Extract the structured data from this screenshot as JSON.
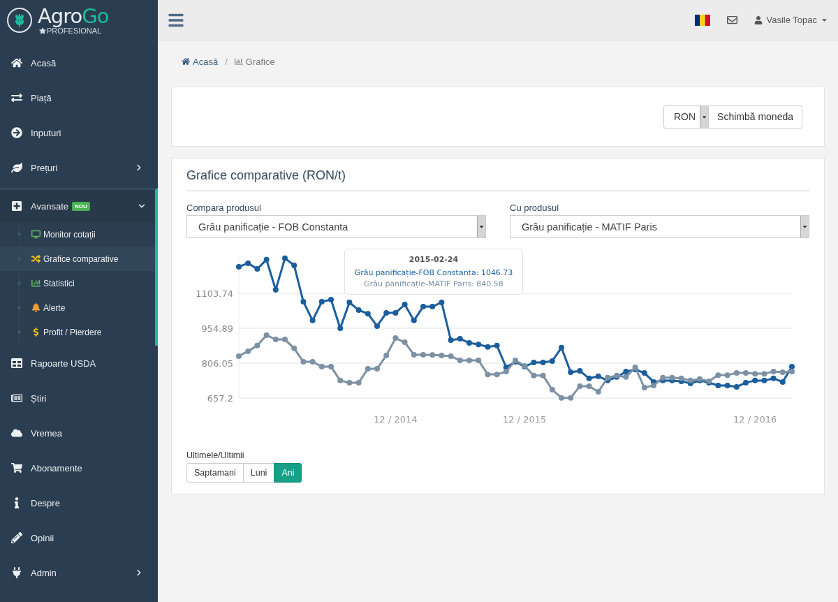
{
  "logo": {
    "name_start": "Agro",
    "name_end": "Go",
    "tagline": "PROFESIONAL"
  },
  "sidebar": {
    "items": [
      {
        "label": "Acasă",
        "selected": false
      },
      {
        "label": "Piață",
        "selected": false
      },
      {
        "label": "Inputuri",
        "selected": false
      },
      {
        "label": "Prețuri",
        "selected": false,
        "expanded": false
      },
      {
        "label": "Avansate",
        "badge": "NOU",
        "selected": true,
        "expanded": true,
        "children": [
          {
            "label": "Monitor cotații",
            "selected": false
          },
          {
            "label": "Grafice comparative",
            "selected": true
          },
          {
            "label": "Statistici",
            "selected": false
          },
          {
            "label": "Alerte",
            "selected": false
          },
          {
            "label": "Profit / Pierdere",
            "selected": false
          }
        ]
      },
      {
        "label": "Rapoarte USDA",
        "selected": false
      },
      {
        "label": "Știri",
        "selected": false
      },
      {
        "label": "Vremea",
        "selected": false
      },
      {
        "label": "Abonamente",
        "selected": false
      },
      {
        "label": "Despre",
        "selected": false
      },
      {
        "label": "Opinii",
        "selected": false
      },
      {
        "label": "Admin",
        "selected": false,
        "expanded": false
      }
    ]
  },
  "header": {
    "user": "Vasile Topac"
  },
  "breadcrumb_separator": "/",
  "breadcrumb": [
    {
      "label": "Acasă",
      "current": false
    },
    {
      "label": "Grafice",
      "current": true
    }
  ],
  "currency": {
    "value": "RON",
    "button": "Schimbă moneda"
  },
  "chart_panel": {
    "title": "Grafice comparative (RON/t)",
    "selects": [
      {
        "label": "Compara produsul",
        "value": "Grâu panificație - FOB Constanta"
      },
      {
        "label": "Cu produsul",
        "value": "Grâu panificație - MATIF Paris"
      }
    ],
    "chart_data": {
      "type": "line",
      "categories": [
        null,
        null,
        null,
        null,
        null,
        null,
        null,
        null,
        null,
        null,
        null,
        null,
        null,
        null,
        null,
        null,
        null,
        "12 / 2014",
        null,
        null,
        null,
        null,
        null,
        null,
        null,
        null,
        null,
        null,
        null,
        null,
        null,
        "12 / 2015",
        null,
        null,
        null,
        null,
        null,
        null,
        null,
        null,
        null,
        null,
        null,
        null,
        null,
        null,
        null,
        null,
        null,
        null,
        null,
        null,
        null,
        null,
        null,
        null,
        "12 / 2016",
        null,
        null,
        null,
        null
      ],
      "series": [
        {
          "name": "Grâu panificație-FOB Constanta",
          "color": "#1a5e9e",
          "marker": "circle",
          "values": [
            1217,
            1232,
            1208,
            1247,
            1119,
            1253,
            1223,
            1068,
            988,
            1068,
            1077,
            955,
            1065,
            1032,
            1017,
            964,
            1020,
            1020,
            1056,
            988,
            1047,
            1047,
            1065,
            904,
            910,
            892,
            886,
            875,
            881,
            788,
            812,
            791,
            809,
            809,
            815,
            872,
            767,
            773,
            741,
            750,
            732,
            747,
            770,
            779,
            764,
            726,
            732,
            732,
            729,
            720,
            732,
            723,
            711,
            711,
            705,
            723,
            732,
            732,
            741,
            726,
            791
          ]
        },
        {
          "name": "Grâu panificație-MATIF Paris",
          "color": "#7d91a5",
          "marker": "circle",
          "values": [
            836,
            857,
            881,
            925,
            907,
            907,
            869,
            812,
            812,
            791,
            791,
            732,
            723,
            723,
            782,
            782,
            839,
            913,
            895,
            842,
            842,
            841,
            839,
            836,
            818,
            818,
            818,
            758,
            758,
            770,
            818,
            794,
            753,
            753,
            693,
            658,
            658,
            708,
            708,
            684,
            744,
            753,
            747,
            788,
            702,
            711,
            744,
            744,
            741,
            732,
            738,
            729,
            755,
            755,
            764,
            764,
            761,
            761,
            770,
            767,
            770
          ]
        }
      ],
      "grid": true,
      "ylim": [
        657.2,
        1260
      ],
      "yticks": [
        {
          "value": 657.2,
          "label": "657.2"
        },
        {
          "value": 806.05,
          "label": "806.05"
        },
        {
          "value": 954.89,
          "label": "954.89"
        },
        {
          "value": 1103.74,
          "label": "1103.74"
        }
      ]
    },
    "tooltip": {
      "title": "2015-02-24",
      "separator": ":",
      "values": [
        "1046.73",
        "840.58"
      ]
    },
    "period": {
      "label": "Ultimele/Ultimii",
      "options": [
        {
          "label": "Saptamani",
          "selected": false
        },
        {
          "label": "Luni",
          "selected": false
        },
        {
          "label": "Ani",
          "selected": true
        }
      ]
    }
  }
}
